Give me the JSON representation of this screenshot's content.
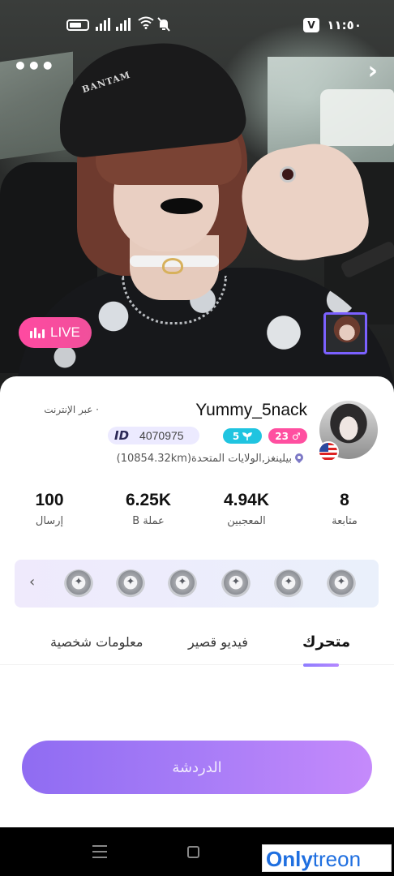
{
  "status_bar": {
    "time": "١١:٥٠",
    "app_icon_letter": "V"
  },
  "photo": {
    "beanie_text": "BANTAM"
  },
  "live": {
    "label": "LIVE"
  },
  "profile": {
    "online_text": "· عبر الإنترنت",
    "username": "Yummy_5nack",
    "id_tag": "ID",
    "id_value": "4070975",
    "level": "5",
    "age": "23",
    "location": "بيلينغز,الولايات المتحدة(10854.32km)"
  },
  "stats": [
    {
      "value": "8",
      "label": "متابعة"
    },
    {
      "value": "4.94K",
      "label": "المعجبين"
    },
    {
      "value": "6.25K",
      "label": "عملة B"
    },
    {
      "value": "100",
      "label": "إرسال"
    }
  ],
  "tabs": {
    "moving": "متحرك",
    "short_video": "فيديو قصير",
    "personal_info": "معلومات شخصية"
  },
  "chat_button": "الدردشة",
  "watermark": {
    "part1": "Only",
    "part2": "treon"
  },
  "colors": {
    "accent": "#8f6cf2",
    "live": "#ff4aa1",
    "level_badge": "#20c4e0",
    "age_badge": "#ff4fa0"
  }
}
